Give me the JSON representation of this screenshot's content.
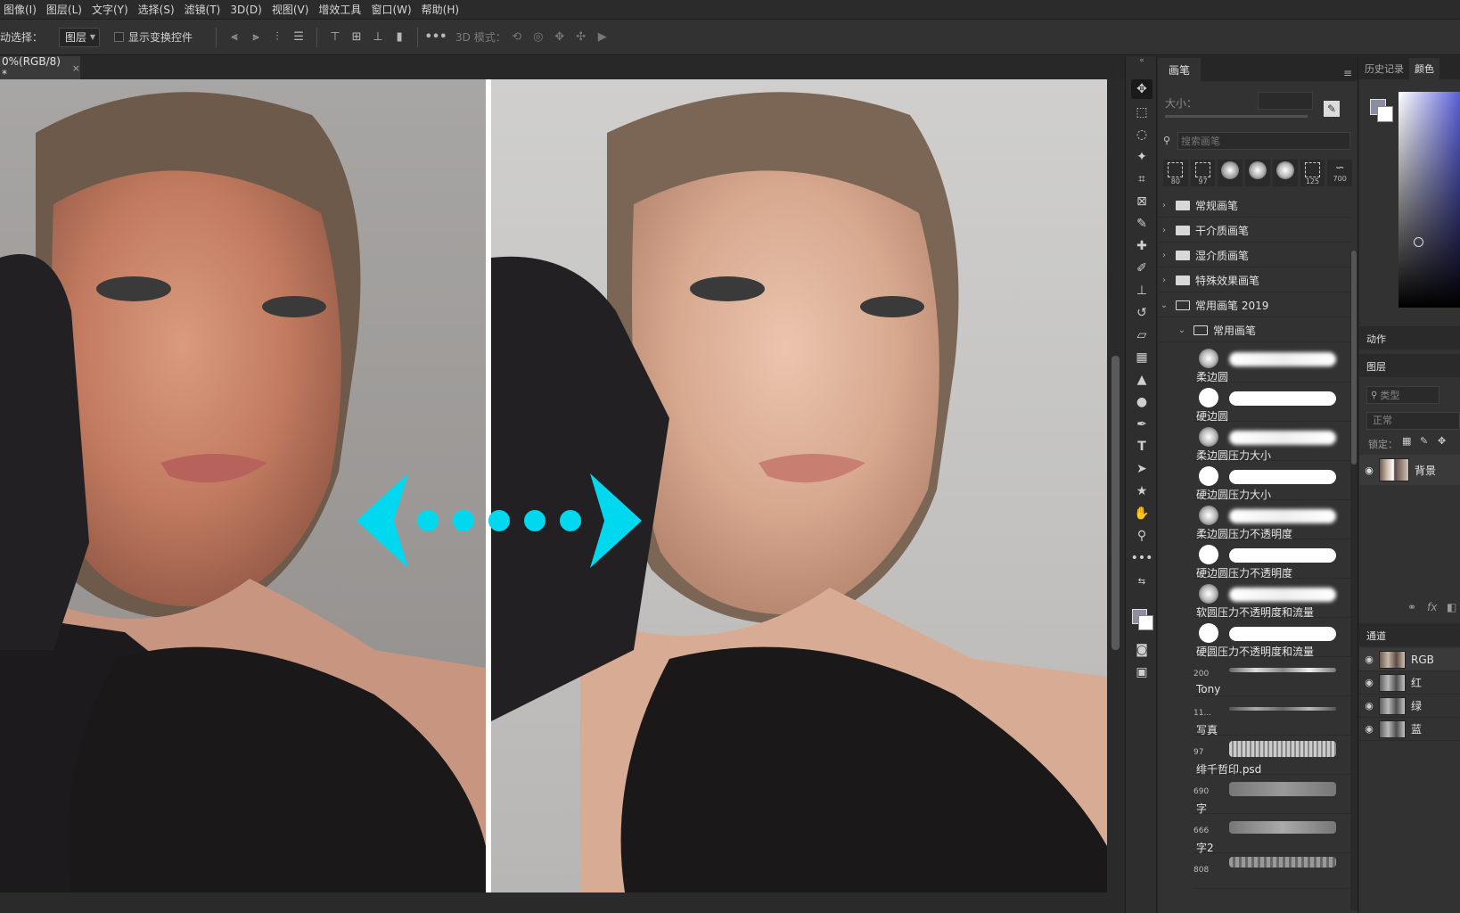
{
  "menu": [
    "图像(I)",
    "图层(L)",
    "文字(Y)",
    "选择(S)",
    "滤镜(T)",
    "3D(D)",
    "视图(V)",
    "增效工具",
    "窗口(W)",
    "帮助(H)"
  ],
  "options": {
    "auto_select_label": "动选择：",
    "layer_dropdown": "图层",
    "show_transform_label": "显示变换控件",
    "three_d_label": "3D 模式："
  },
  "document": {
    "tab_title": "0%(RGB/8) *",
    "close": "×"
  },
  "brush_panel": {
    "tab": "画笔",
    "size_label": "大小：",
    "search_placeholder": "搜索画笔",
    "preset_numbers": [
      "80",
      "97",
      "",
      "",
      "",
      "125",
      "700"
    ],
    "folders": [
      "常规画笔",
      "干介质画笔",
      "湿介质画笔",
      "特殊效果画笔",
      "常用画笔 2019"
    ],
    "subfolder": "常用画笔",
    "brushes": [
      {
        "name": "柔边圆",
        "num": ""
      },
      {
        "name": "硬边圆",
        "num": ""
      },
      {
        "name": "柔边圆压力大小",
        "num": ""
      },
      {
        "name": "硬边圆压力大小",
        "num": ""
      },
      {
        "name": "柔边圆压力不透明度",
        "num": ""
      },
      {
        "name": "硬边圆压力不透明度",
        "num": ""
      },
      {
        "name": "软圆压力不透明度和流量",
        "num": ""
      },
      {
        "name": "硬圆压力不透明度和流量",
        "num": ""
      },
      {
        "name": "Tony",
        "num": "200"
      },
      {
        "name": "写真",
        "num": "11..."
      },
      {
        "name": "绯千哲印.psd",
        "num": "97"
      },
      {
        "name": "字",
        "num": "690"
      },
      {
        "name": "字2",
        "num": "666"
      },
      {
        "name": "",
        "num": "808"
      }
    ]
  },
  "right_panels": {
    "history_tab": "历史记录",
    "color_tab": "颜色",
    "actions_label": "动作",
    "layers_label": "图层",
    "kind_filter": "类型",
    "blend_mode": "正常",
    "lock_label": "锁定：",
    "layer_name": "背景",
    "fx": "fx",
    "channels_label": "通道",
    "channels": [
      "RGB",
      "红",
      "绿",
      "蓝"
    ]
  },
  "colors": {
    "accent_arrow": "#00d8f0",
    "panel_bg": "#323232"
  }
}
